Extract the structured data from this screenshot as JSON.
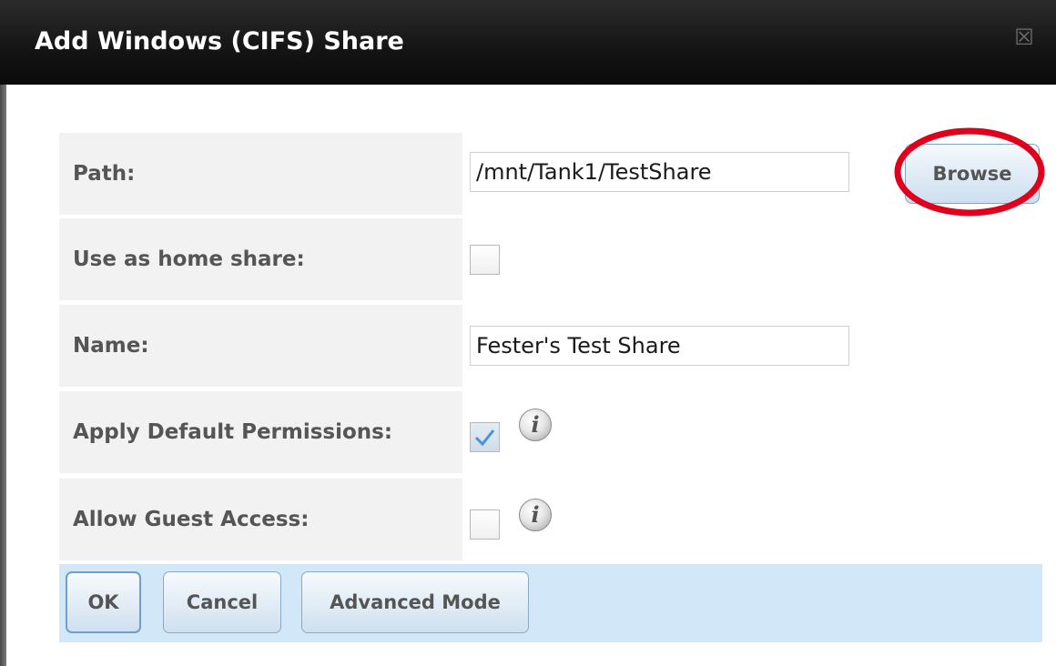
{
  "dialog": {
    "title": "Add Windows (CIFS) Share",
    "close_glyph": "☒"
  },
  "form": {
    "path": {
      "label": "Path:",
      "value": "/mnt/Tank1/TestShare",
      "browse_label": "Browse"
    },
    "home_share": {
      "label": "Use as home share:",
      "checked": false
    },
    "name": {
      "label": "Name:",
      "value": "Fester's Test Share"
    },
    "default_permissions": {
      "label": "Apply Default Permissions:",
      "checked": true,
      "info_icon": "i"
    },
    "guest_access": {
      "label": "Allow Guest Access:",
      "checked": false,
      "info_icon": "i"
    }
  },
  "buttons": {
    "ok": "OK",
    "cancel": "Cancel",
    "advanced": "Advanced Mode"
  },
  "colors": {
    "titlebar": "#141414",
    "footer": "#d2e7f8",
    "label_bg": "#f2f2f2",
    "highlight": "#e0001b"
  }
}
